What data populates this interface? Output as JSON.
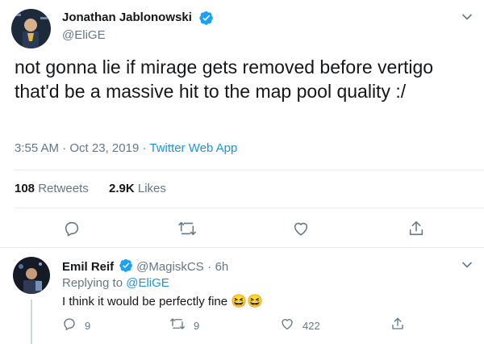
{
  "main_tweet": {
    "author_name": "Jonathan Jablonowski",
    "author_handle": "@EliGE",
    "text": "not gonna lie if mirage gets removed before vertigo that'd be a massive hit to the map pool quality :/",
    "time": "3:55 AM",
    "date": "Oct 23, 2019",
    "separator": "·",
    "source": "Twitter Web App",
    "retweets_count": "108",
    "retweets_label": "Retweets",
    "likes_count": "2.9K",
    "likes_label": "Likes"
  },
  "reply": {
    "author_name": "Emil Reif",
    "author_handle": "@MagiskCS",
    "separator": "·",
    "age": "6h",
    "replying_prefix": "Replying to",
    "replying_to": "@EliGE",
    "text": "I think it would be perfectly fine",
    "emoji": "😆😆",
    "reply_count": "9",
    "retweet_count": "9",
    "like_count": "422"
  },
  "icons": [
    "verified-badge-icon",
    "chevron-down-icon",
    "reply-icon",
    "retweet-icon",
    "like-icon",
    "share-icon"
  ],
  "colors": {
    "brand_blue": "#1da1f2",
    "link": "#1b95e0",
    "muted": "#657786",
    "divider": "#e6ecf0"
  }
}
